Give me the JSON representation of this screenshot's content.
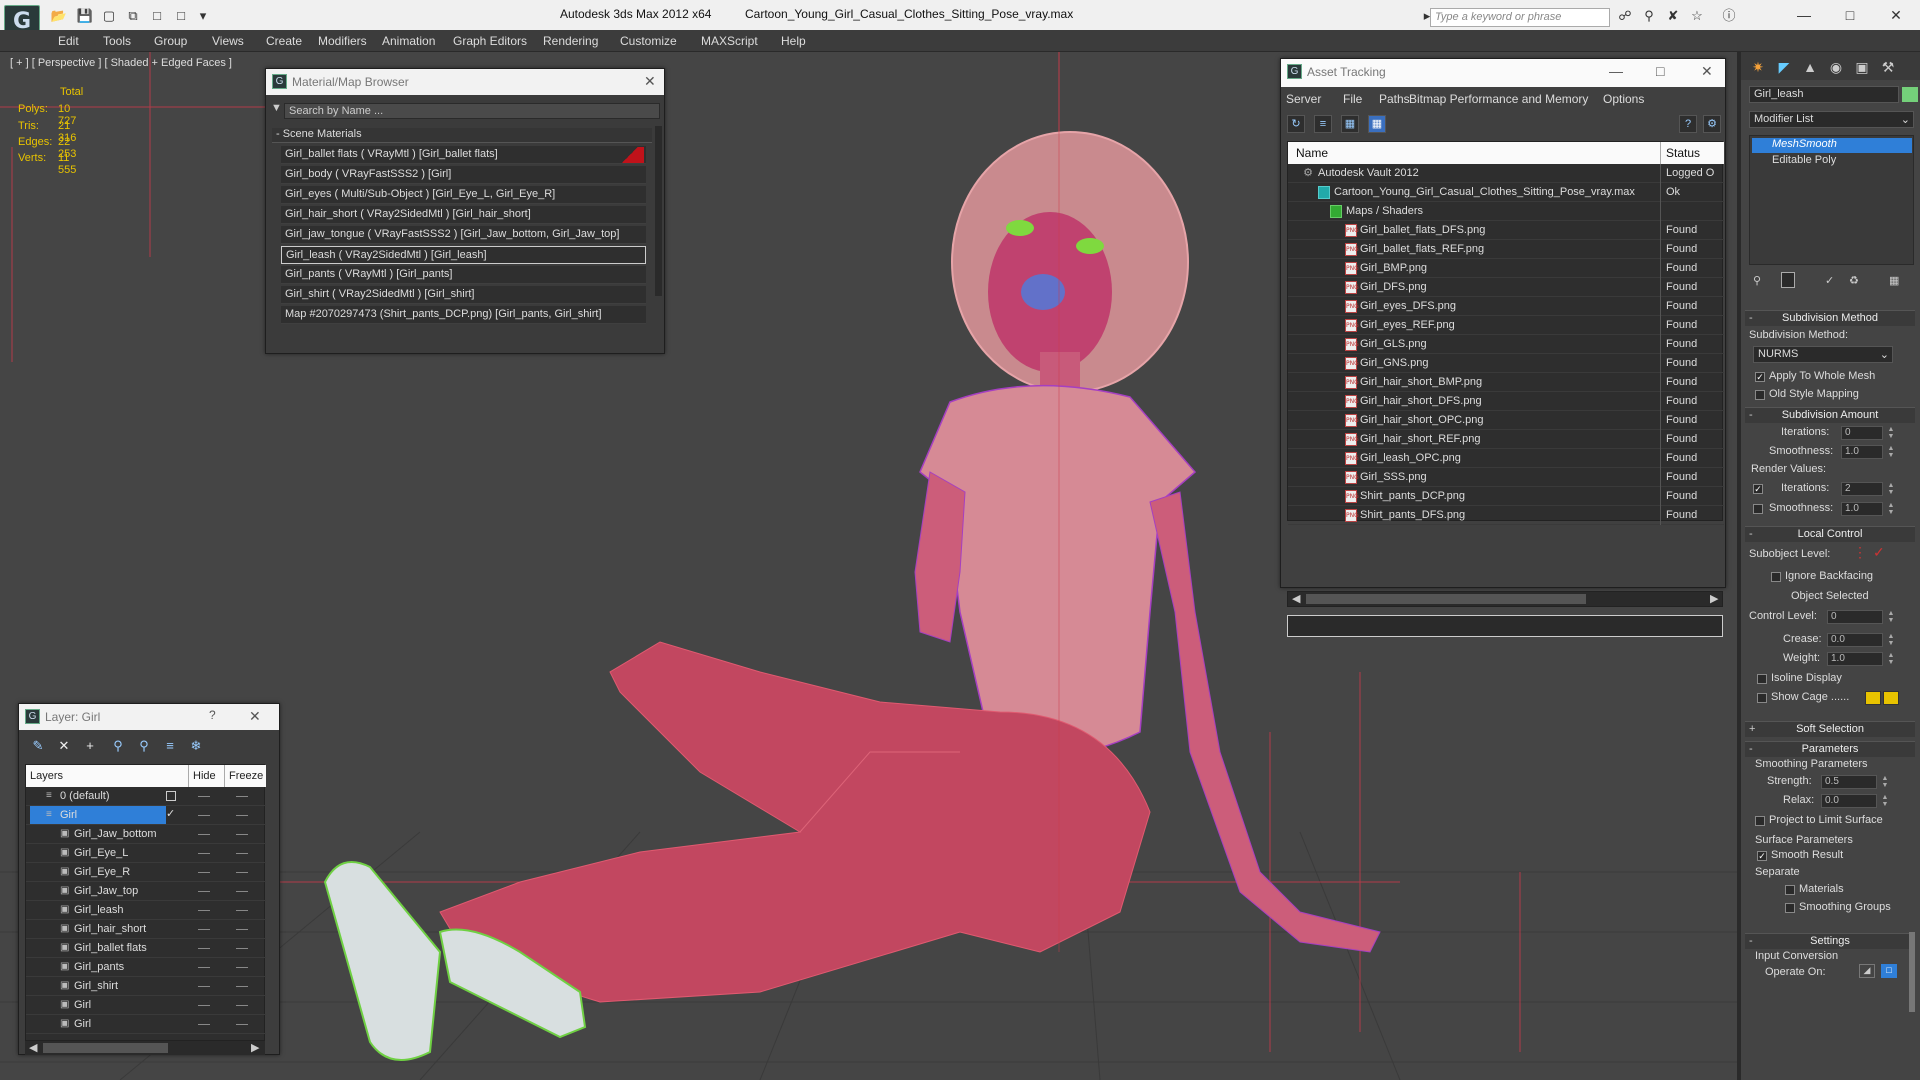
{
  "app": {
    "title": "Autodesk 3ds Max  2012 x64",
    "filename": "Cartoon_Young_Girl_Casual_Clothes_Sitting_Pose_vray.max",
    "search_placeholder": "Type a keyword or phrase"
  },
  "menu": [
    "Edit",
    "Tools",
    "Group",
    "Views",
    "Create",
    "Modifiers",
    "Animation",
    "Graph Editors",
    "Rendering",
    "Customize",
    "MAXScript",
    "Help"
  ],
  "viewport": {
    "label": "[ + ] [ Perspective ] [ Shaded + Edged Faces ]",
    "stats_header": "Total",
    "stats": [
      {
        "label": "Polys:",
        "value": "10 727"
      },
      {
        "label": "Tris:",
        "value": "21 316"
      },
      {
        "label": "Edges:",
        "value": "22 253"
      },
      {
        "label": "Verts:",
        "value": "11 555"
      }
    ]
  },
  "material_browser": {
    "title": "Material/Map Browser",
    "search_placeholder": "Search by Name ...",
    "section": "- Scene Materials",
    "items": [
      "Girl_ballet flats  ( VRayMtl )  [Girl_ballet flats]",
      "Girl_body  ( VRayFastSSS2 )  [Girl]",
      "Girl_eyes  ( Multi/Sub-Object )  [Girl_Eye_L, Girl_Eye_R]",
      "Girl_hair_short  ( VRay2SidedMtl )  [Girl_hair_short]",
      "Girl_jaw_tongue  ( VRayFastSSS2 )  [Girl_Jaw_bottom, Girl_Jaw_top]",
      "Girl_leash  ( VRay2SidedMtl )  [Girl_leash]",
      "Girl_pants  ( VRayMtl )  [Girl_pants]",
      "Girl_shirt  ( VRay2SidedMtl )  [Girl_shirt]",
      "Map #2070297473 (Shirt_pants_DCP.png)  [Girl_pants, Girl_shirt]"
    ]
  },
  "asset_tracking": {
    "title": "Asset Tracking",
    "menu": [
      "Server",
      "File",
      "Paths",
      "Bitmap Performance and Memory",
      "Options"
    ],
    "col_name": "Name",
    "col_status": "Status",
    "rows": [
      {
        "name": "Autodesk Vault 2012",
        "status": "Logged O",
        "level": 0
      },
      {
        "name": "Cartoon_Young_Girl_Casual_Clothes_Sitting_Pose_vray.max",
        "status": "Ok",
        "level": 1
      },
      {
        "name": "Maps / Shaders",
        "status": "",
        "level": 2
      },
      {
        "name": "Girl_ballet_flats_DFS.png",
        "status": "Found",
        "level": 3
      },
      {
        "name": "Girl_ballet_flats_REF.png",
        "status": "Found",
        "level": 3
      },
      {
        "name": "Girl_BMP.png",
        "status": "Found",
        "level": 3
      },
      {
        "name": "Girl_DFS.png",
        "status": "Found",
        "level": 3
      },
      {
        "name": "Girl_eyes_DFS.png",
        "status": "Found",
        "level": 3
      },
      {
        "name": "Girl_eyes_REF.png",
        "status": "Found",
        "level": 3
      },
      {
        "name": "Girl_GLS.png",
        "status": "Found",
        "level": 3
      },
      {
        "name": "Girl_GNS.png",
        "status": "Found",
        "level": 3
      },
      {
        "name": "Girl_hair_short_BMP.png",
        "status": "Found",
        "level": 3
      },
      {
        "name": "Girl_hair_short_DFS.png",
        "status": "Found",
        "level": 3
      },
      {
        "name": "Girl_hair_short_OPC.png",
        "status": "Found",
        "level": 3
      },
      {
        "name": "Girl_hair_short_REF.png",
        "status": "Found",
        "level": 3
      },
      {
        "name": "Girl_leash_OPC.png",
        "status": "Found",
        "level": 3
      },
      {
        "name": "Girl_SSS.png",
        "status": "Found",
        "level": 3
      },
      {
        "name": "Shirt_pants_DCP.png",
        "status": "Found",
        "level": 3
      },
      {
        "name": "Shirt_pants_DFS.png",
        "status": "Found",
        "level": 3
      }
    ]
  },
  "layer_panel": {
    "title": "Layer: Girl",
    "help": "?",
    "col_layers": "Layers",
    "col_hide": "Hide",
    "col_freeze": "Freeze",
    "rows": [
      {
        "name": "0 (default)",
        "level": 0,
        "selected": false
      },
      {
        "name": "Girl",
        "level": 0,
        "selected": true
      },
      {
        "name": "Girl_Jaw_bottom",
        "level": 1,
        "selected": false
      },
      {
        "name": "Girl_Eye_L",
        "level": 1,
        "selected": false
      },
      {
        "name": "Girl_Eye_R",
        "level": 1,
        "selected": false
      },
      {
        "name": "Girl_Jaw_top",
        "level": 1,
        "selected": false
      },
      {
        "name": "Girl_leash",
        "level": 1,
        "selected": false
      },
      {
        "name": "Girl_hair_short",
        "level": 1,
        "selected": false
      },
      {
        "name": "Girl_ballet flats",
        "level": 1,
        "selected": false
      },
      {
        "name": "Girl_pants",
        "level": 1,
        "selected": false
      },
      {
        "name": "Girl_shirt",
        "level": 1,
        "selected": false
      },
      {
        "name": "Girl",
        "level": 1,
        "selected": false
      },
      {
        "name": "Girl",
        "level": 1,
        "selected": false
      }
    ]
  },
  "command_panel": {
    "object_name": "Girl_leash",
    "object_color": "#74d07a",
    "modifier_list": "Modifier List",
    "stack": [
      "MeshSmooth",
      "Editable Poly"
    ],
    "subdivision_method": {
      "title": "Subdivision Method",
      "label": "Subdivision Method:",
      "value": "NURMS",
      "apply_whole_mesh": "Apply To Whole Mesh",
      "old_style_mapping": "Old Style Mapping"
    },
    "subdivision_amount": {
      "title": "Subdivision Amount",
      "iterations_label": "Iterations:",
      "iterations_value": "0",
      "smoothness_label": "Smoothness:",
      "smoothness_value": "1.0",
      "render_values": "Render Values:",
      "render_iterations_label": "Iterations:",
      "render_iterations_value": "2",
      "render_smoothness_label": "Smoothness:",
      "render_smoothness_value": "1.0"
    },
    "local_control": {
      "title": "Local Control",
      "subobject_level": "Subobject Level:",
      "ignore_backfacing": "Ignore Backfacing",
      "object_selected": "Object Selected",
      "control_level_label": "Control Level:",
      "control_level_value": "0",
      "crease_label": "Crease:",
      "crease_value": "0.0",
      "weight_label": "Weight:",
      "weight_value": "1.0",
      "isoline_display": "Isoline Display",
      "show_cage": "Show Cage ......"
    },
    "soft_selection": {
      "title": "Soft Selection"
    },
    "parameters": {
      "title": "Parameters",
      "smoothing_parameters": "Smoothing Parameters",
      "strength_label": "Strength:",
      "strength_value": "0.5",
      "relax_label": "Relax:",
      "relax_value": "0.0",
      "project_limit": "Project to Limit Surface",
      "surface_parameters": "Surface Parameters",
      "smooth_result": "Smooth Result",
      "separate": "Separate",
      "materials": "Materials",
      "smoothing_groups": "Smoothing Groups"
    },
    "settings": {
      "title": "Settings",
      "input_conversion": "Input Conversion",
      "operate_on": "Operate On:"
    }
  }
}
